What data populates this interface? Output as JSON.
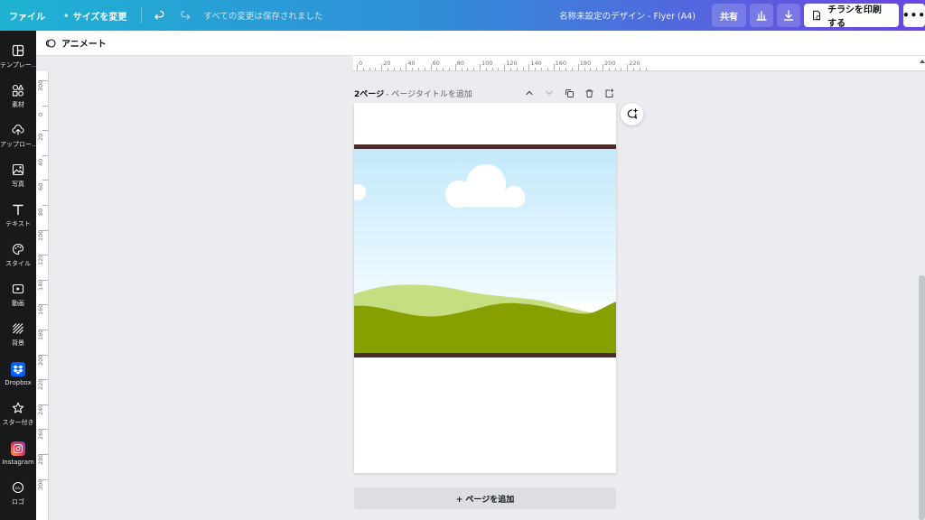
{
  "topbar": {
    "file_label": "ファイル",
    "resize_label": "サイズを変更",
    "saved_status": "すべての変更は保存されました",
    "doc_title": "名称未設定のデザイン - Flyer (A4)",
    "share_label": "共有",
    "print_label": "チラシを印刷する"
  },
  "sidebar": {
    "items": [
      {
        "label": "テンプレー…",
        "icon": "template-icon"
      },
      {
        "label": "素材",
        "icon": "elements-icon"
      },
      {
        "label": "アップロー…",
        "icon": "upload-icon"
      },
      {
        "label": "写真",
        "icon": "photo-icon"
      },
      {
        "label": "テキスト",
        "icon": "text-icon"
      },
      {
        "label": "スタイル",
        "icon": "palette-icon"
      },
      {
        "label": "動画",
        "icon": "video-icon"
      },
      {
        "label": "背景",
        "icon": "background-icon"
      },
      {
        "label": "Dropbox",
        "icon": "dropbox-icon"
      },
      {
        "label": "スター付き",
        "icon": "star-icon"
      },
      {
        "label": "Instagram",
        "icon": "instagram-icon"
      },
      {
        "label": "ロゴ",
        "icon": "logo-icon"
      }
    ]
  },
  "subbar": {
    "animate_label": "アニメート"
  },
  "ruler": {
    "top_labels": [
      "0",
      "20",
      "40",
      "60",
      "80",
      "100",
      "120",
      "140",
      "160",
      "180",
      "200",
      "220"
    ],
    "left_labels": [
      "300",
      "0",
      "20",
      "40",
      "60",
      "80",
      "100",
      "120",
      "140",
      "160",
      "180",
      "200",
      "220",
      "240",
      "260",
      "280",
      "300"
    ]
  },
  "page": {
    "number": "2ページ",
    "title_placeholder": " - ページタイトルを追加"
  },
  "add_page_label": "+ ページを追加",
  "colors": {
    "sky_top": "#c3e9fb",
    "sky_bottom": "#f2fbff",
    "hill_light": "#c5de82",
    "hill_dark": "#87a000",
    "band": "#4a2c2c",
    "sidebar_bg": "#18191b"
  }
}
